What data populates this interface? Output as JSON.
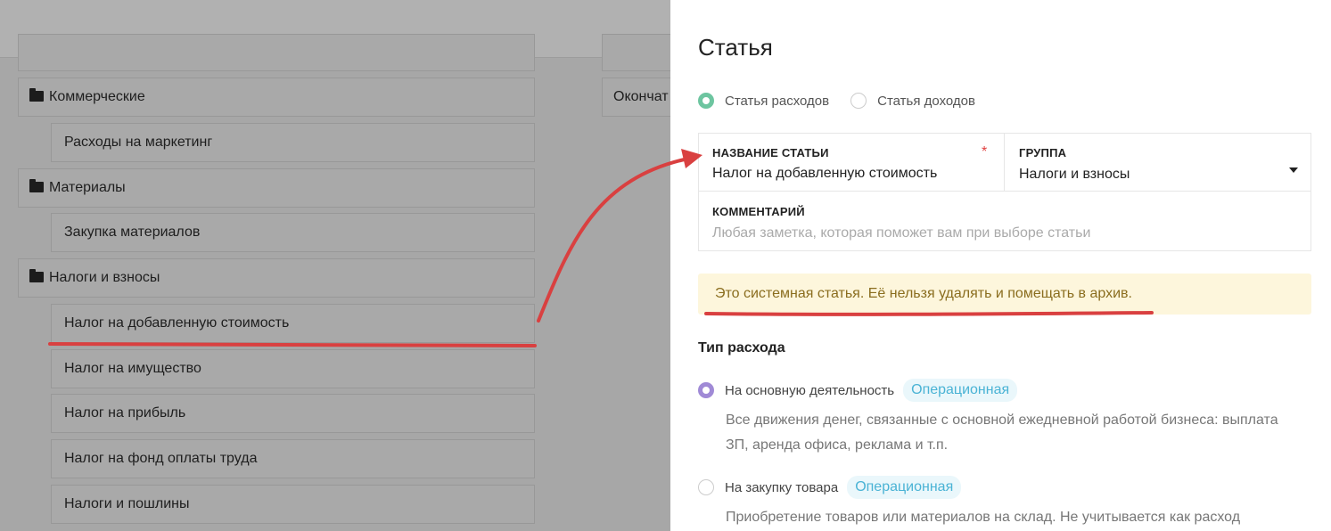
{
  "background_list": {
    "partial_top": "",
    "items": [
      {
        "type": "group",
        "label": "Коммерческие"
      },
      {
        "type": "child",
        "label": "Расходы на маркетинг"
      },
      {
        "type": "group",
        "label": "Материалы"
      },
      {
        "type": "child",
        "label": "Закупка материалов"
      },
      {
        "type": "group",
        "label": "Налоги и взносы"
      },
      {
        "type": "child",
        "label": "Налог на добавленную стоимость"
      },
      {
        "type": "child",
        "label": "Налог на имущество"
      },
      {
        "type": "child",
        "label": "Налог на прибыль"
      },
      {
        "type": "child",
        "label": "Налог на фонд оплаты труда"
      },
      {
        "type": "child",
        "label": "Налоги и пошлины"
      }
    ],
    "side_item_label": "Окончат"
  },
  "panel": {
    "title": "Статья",
    "kind_options": [
      {
        "label": "Статья расходов",
        "selected": true
      },
      {
        "label": "Статья доходов",
        "selected": false
      }
    ],
    "name_field": {
      "label": "НАЗВАНИЕ СТАТЬИ",
      "required_mark": "*",
      "value": "Налог на добавленную стоимость"
    },
    "group_field": {
      "label": "ГРУППА",
      "value": "Налоги и взносы"
    },
    "comment_field": {
      "label": "КОММЕНТАРИЙ",
      "placeholder": "Любая заметка, которая поможет вам при выборе статьи"
    },
    "notice": "Это системная статья. Её нельзя удалять и помещать в архив.",
    "expense_type": {
      "title": "Тип расхода",
      "options": [
        {
          "label": "На основную деятельность",
          "badge": "Операционная",
          "selected": true,
          "description_lines": [
            "Все движения денег, связанные с основной ежедневной работой бизнеса: выплата",
            "ЗП, аренда офиса, реклама и т.п."
          ]
        },
        {
          "label": "На закупку товара",
          "badge": "Операционная",
          "selected": false,
          "description_lines": [
            "Приобретение товаров или материалов на склад. Не учитывается как расход"
          ]
        }
      ]
    }
  },
  "colors": {
    "annotation_red": "#d94040",
    "radio_selected_green": "#6dc5a0",
    "radio_selected_purple": "#a08ad6",
    "badge_text": "#4ab3d5",
    "notice_bg": "#fdf6dc"
  }
}
